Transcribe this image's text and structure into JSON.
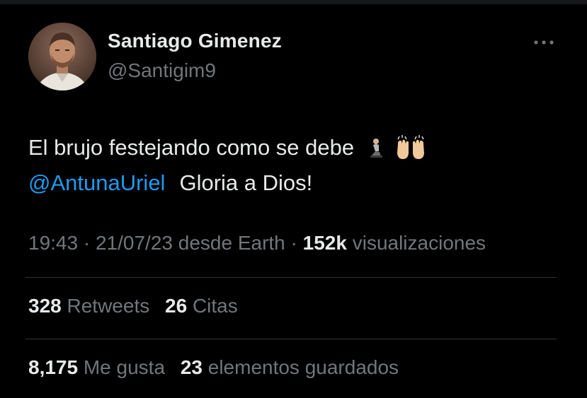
{
  "author": {
    "display_name": "Santiago Gimenez",
    "handle": "@Santigim9"
  },
  "tweet": {
    "text_line1": "El brujo festejando como se debe",
    "emojis": [
      "kneeling-person",
      "raising-hands"
    ],
    "mention": "@AntunaUriel",
    "text_line2": "Gloria a Dios!"
  },
  "meta": {
    "time": "19:43",
    "separator": "·",
    "date": "21/07/23",
    "source": "desde Earth",
    "views_count": "152k",
    "views_label": "visualizaciones"
  },
  "stats": {
    "retweets_count": "328",
    "retweets_label": "Retweets",
    "quotes_count": "26",
    "quotes_label": "Citas",
    "likes_count": "8,175",
    "likes_label": "Me gusta",
    "bookmarks_count": "23",
    "bookmarks_label": "elementos guardados"
  },
  "colors": {
    "background": "#000000",
    "text_primary": "#e7e9ea",
    "text_secondary": "#71767b",
    "link": "#1d9bf0",
    "divider": "#2f3336"
  }
}
